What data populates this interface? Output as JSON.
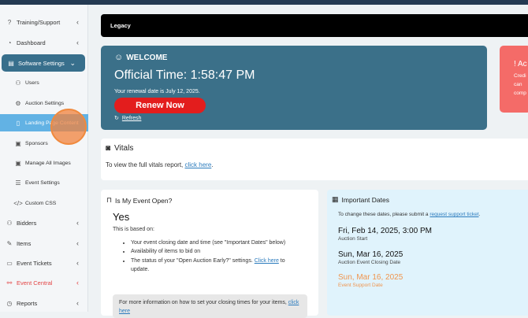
{
  "sidebar": {
    "items": [
      {
        "label": "Training/Support",
        "icon": "help-circle-icon",
        "chevron": "‹"
      },
      {
        "label": "Dashboard",
        "icon": "dashboard-icon",
        "chevron": "‹"
      },
      {
        "label": "Software Settings",
        "icon": "settings-panel-icon",
        "chevron": "⌄"
      },
      {
        "label": "Users",
        "icon": "users-icon"
      },
      {
        "label": "Auction Settings",
        "icon": "gear-icon"
      },
      {
        "label": "Landing Page Content",
        "icon": "document-icon"
      },
      {
        "label": "Sponsors",
        "icon": "image-icon"
      },
      {
        "label": "Manage All Images",
        "icon": "images-icon"
      },
      {
        "label": "Event Settings",
        "icon": "list-icon"
      },
      {
        "label": "Custom CSS",
        "icon": "code-icon"
      },
      {
        "label": "Bidders",
        "icon": "users-icon",
        "chevron": "‹"
      },
      {
        "label": "Items",
        "icon": "wrench-icon",
        "chevron": "‹"
      },
      {
        "label": "Event Tickets",
        "icon": "ticket-icon",
        "chevron": "‹"
      },
      {
        "label": "Event Central",
        "icon": "event-central-icon",
        "chevron": "‹"
      },
      {
        "label": "Reports",
        "icon": "reports-icon",
        "chevron": "‹"
      }
    ]
  },
  "header": {
    "legacy_label": "Legacy"
  },
  "welcome": {
    "title": "WELCOME",
    "official_time": "Official Time: 1:58:47 PM",
    "renewal_text": "Your renewal date is July 12, 2025.",
    "renew_button": "Renew Now",
    "refresh_label": "Refresh"
  },
  "alert": {
    "title": "! Ac",
    "lines": [
      "Credi",
      "can",
      "comp"
    ]
  },
  "vitals": {
    "title": "Vitals",
    "text": "To view the full vitals report, ",
    "link": "click here",
    "suffix": "."
  },
  "event_open": {
    "title": "Is My Event Open?",
    "status": "Yes",
    "based_on": "This is based on:",
    "bullets": [
      "Your event closing date and time (see \"Important Dates\" below)",
      "Availability of items to bid on"
    ],
    "bullet3_prefix": "The status of your \"Open Auction Early?\" settings. ",
    "bullet3_link": "Click here",
    "bullet3_suffix": " to update.",
    "info_text": "For more information on how to set your closing times for your items, ",
    "info_link": "click here"
  },
  "dates": {
    "title": "Important Dates",
    "info_prefix": "To change these dates, please submit a ",
    "info_link": "request support ticket",
    "info_suffix": ".",
    "items": [
      {
        "value": "Fri, Feb 14, 2025, 3:00 PM",
        "label": "Auction Start"
      },
      {
        "value": "Sun, Mar 16, 2025",
        "label": "Auction Event Closing Date"
      },
      {
        "value": "Sun, Mar 16, 2025",
        "label": "Event Support Date"
      }
    ]
  },
  "colors": {
    "sidebar_active": "#386f8c",
    "sub_active": "#62b2e4",
    "welcome_bg": "#3b7089",
    "renew_red": "#e31d1d",
    "alert_bg": "#f46b68",
    "event_central_red": "#e34444",
    "dates_bg": "#e0f3fc",
    "support_date_orange": "#f0954e"
  }
}
